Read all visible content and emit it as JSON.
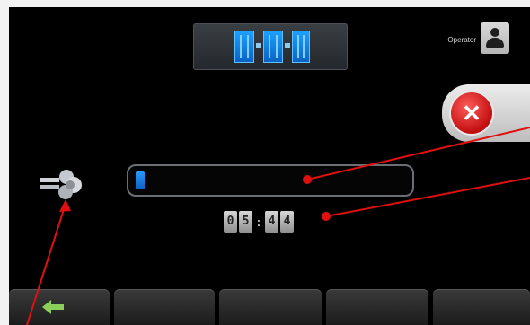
{
  "operator": {
    "label": "Operator",
    "icon": "user-icon"
  },
  "status": {
    "icon": "mode-blocks-icon",
    "accent_color": "#1e90ff"
  },
  "close_button": {
    "icon": "close-icon",
    "color": "#d61a1a"
  },
  "fan": {
    "icon": "fan-icon"
  },
  "progress": {
    "value": 0.02,
    "fill_color": "#1e90ff"
  },
  "timer": {
    "minutes": [
      "0",
      "5"
    ],
    "separator": ":",
    "seconds": [
      "4",
      "4"
    ]
  },
  "nav": {
    "back_icon": "left-arrow-icon",
    "back_color": "#8bcf5a",
    "buttons": [
      "",
      "",
      "",
      ""
    ]
  },
  "annotation_color": "#e01010"
}
